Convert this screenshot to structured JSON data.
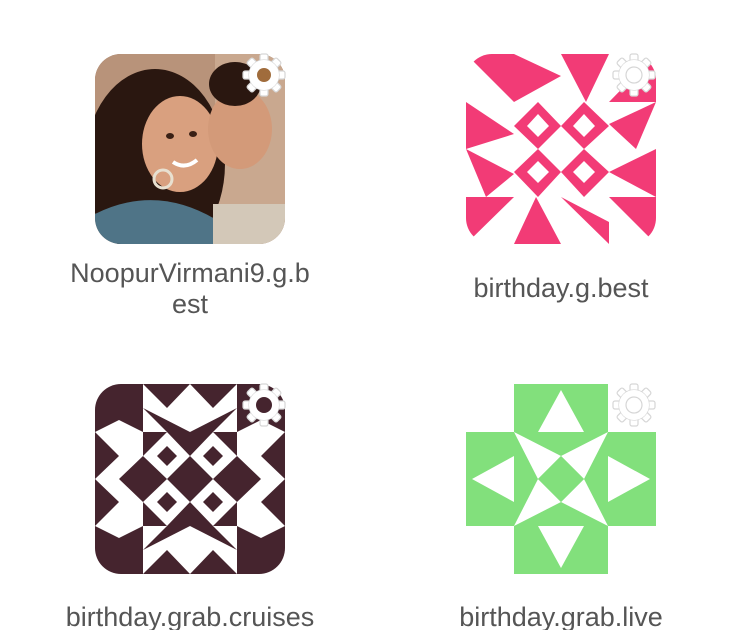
{
  "accounts": [
    {
      "name": "NoopurVirmani9.g.b\nest",
      "avatar_type": "photo",
      "colors": {
        "background": "#a0785c",
        "hair": "#2a1710",
        "skin": "#d9a07f"
      },
      "settings_icon": "gear-icon"
    },
    {
      "name": "birthday.g.best",
      "avatar_type": "identicon",
      "colors": {
        "foreground": "#f23b76",
        "background": "#ffffff"
      },
      "settings_icon": "gear-icon"
    },
    {
      "name": "birthday.grab.cruises",
      "avatar_type": "identicon",
      "colors": {
        "foreground": "#45242e",
        "background": "#ffffff"
      },
      "settings_icon": "gear-icon"
    },
    {
      "name": "birthday.grab.live",
      "avatar_type": "identicon",
      "colors": {
        "foreground": "#82e07c",
        "background": "#ffffff"
      },
      "settings_icon": "gear-icon"
    }
  ]
}
